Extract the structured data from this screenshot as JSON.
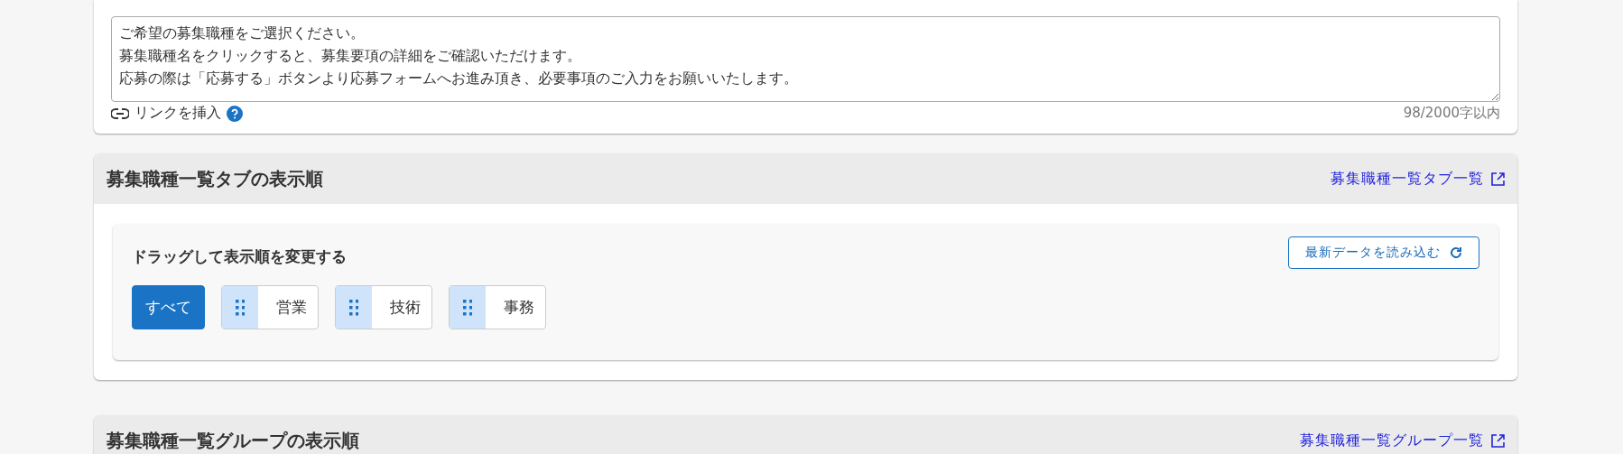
{
  "message_card": {
    "message_lines": [
      "ご希望の募集職種をご選択ください。",
      "募集職種名をクリックすると、募集要項の詳細をご確認いただけます。",
      "応募の際は「応募する」ボタンより応募フォームへお進み頂き、必要事項のご入力をお願いいたします。"
    ],
    "insert_link": "リンクを挿入",
    "char_count": "98/2000字以内"
  },
  "sections": [
    {
      "title": "募集職種一覧タブの表示順",
      "link": "募集職種一覧タブ一覧",
      "panel": {
        "heading": "ドラッグして表示順を変更する",
        "reload_button": "最新データを読み込む",
        "tabs": [
          {
            "label": "すべて",
            "kind": "fixed",
            "selected": true
          },
          {
            "label": "営業",
            "kind": "draggable",
            "selected": false
          },
          {
            "label": "技術",
            "kind": "draggable",
            "selected": false
          },
          {
            "label": "事務",
            "kind": "draggable",
            "selected": false
          }
        ]
      }
    },
    {
      "title": "募集職種一覧グループの表示順",
      "link": "募集職種一覧グループ一覧"
    }
  ]
}
